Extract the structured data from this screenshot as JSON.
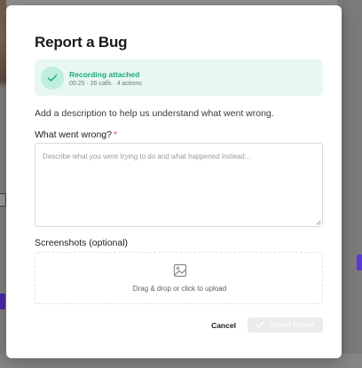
{
  "modal": {
    "title": "Report a Bug",
    "banner": {
      "title": "Recording attached",
      "subtitle": "00:25 · 26 calls · 4 actions",
      "icon": "check-icon",
      "accent": "#1aa876"
    },
    "description": "Add a description to help us understand what went wrong.",
    "what_went_wrong": {
      "label": "What went wrong?",
      "required_marker": "*",
      "value": "",
      "placeholder": "Describe what you were trying to do and what happened instead..."
    },
    "screenshots": {
      "label": "Screenshots (optional)",
      "dropzone_text": "Drag & drop or click to upload",
      "icon": "image-icon"
    },
    "actions": {
      "cancel_label": "Cancel",
      "submit_label": "Submit Report",
      "submit_icon": "check-icon"
    }
  }
}
